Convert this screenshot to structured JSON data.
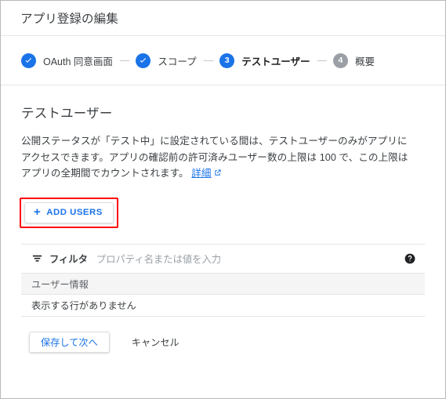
{
  "window": {
    "title": "アプリ登録の編集"
  },
  "stepper": {
    "separator": "—",
    "steps": [
      {
        "id": "oauth-consent",
        "marker": "check",
        "label": "OAuth 同意画面",
        "state": "done"
      },
      {
        "id": "scopes",
        "marker": "check",
        "label": "スコープ",
        "state": "done"
      },
      {
        "id": "test-users",
        "marker": "3",
        "label": "テストユーザー",
        "state": "current"
      },
      {
        "id": "summary",
        "marker": "4",
        "label": "概要",
        "state": "todo"
      }
    ]
  },
  "main": {
    "section_title": "テストユーザー",
    "description_part1": "公開ステータスが「テスト中」に設定されている間は、テストユーザーのみがアプリにアクセスできます。アプリの確認前の許可済みユーザー数の上限は 100 で、この上限はアプリの全期間でカウントされます。",
    "description_link": "詳細",
    "add_users_button": "ADD USERS",
    "add_users_plus": "+"
  },
  "table": {
    "filter_label": "フィルタ",
    "filter_placeholder": "プロパティ名または値を入力",
    "columns": [
      "ユーザー情報"
    ],
    "empty_message": "表示する行がありません"
  },
  "footer": {
    "save_label": "保存して次へ",
    "cancel_label": "キャンセル"
  },
  "colors": {
    "accent": "#1a73e8",
    "muted": "#9aa0a6",
    "highlight": "#ff0000",
    "text": "#3c4043",
    "border": "#e6e6e6",
    "header_bg": "#f5f5f5"
  }
}
